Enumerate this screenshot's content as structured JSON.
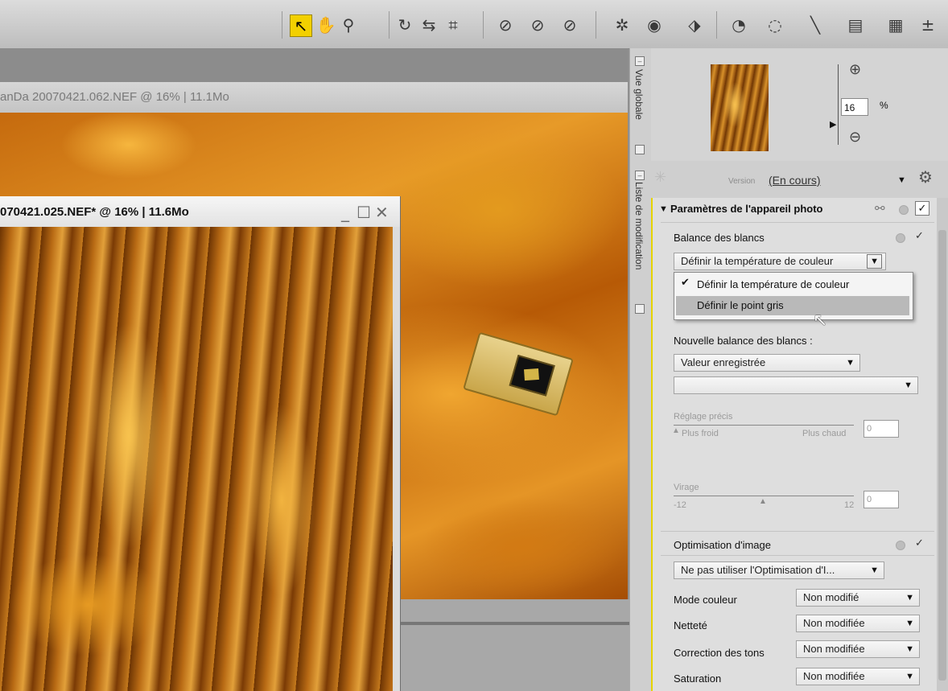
{
  "toolbar": {
    "tools": [
      "select-arrow-icon",
      "hand-icon",
      "magnify-icon",
      "rotate-icon",
      "straighten-icon",
      "crop-icon",
      "redeye-icon",
      "redeye2-icon",
      "redeye3-icon",
      "color-picker-icon",
      "eye-icon",
      "tag-icon",
      "control-point-icon",
      "color-control-point-icon",
      "line-brush-icon",
      "gradient-icon",
      "selection-icon"
    ],
    "active": "select-arrow-icon"
  },
  "window1": {
    "title": "anDa 20070421.062.NEF @ 16% | 11.1Mo"
  },
  "window2": {
    "title": "070421.025.NEF* @ 16% | 11.6Mo"
  },
  "sidestrip": {
    "overview_label": "Vue globale",
    "edit_list_label": "Liste de modification"
  },
  "overview": {
    "zoom_value": "16",
    "zoom_unit": "%"
  },
  "version": {
    "label": "Version",
    "value": "(En cours)"
  },
  "panel": {
    "section_title": "Paramètres de l'appareil photo",
    "white_balance": {
      "label": "Balance des blancs",
      "dropdown_value": "Définir la température de couleur",
      "options": [
        "Définir la température de couleur",
        "Définir le point gris"
      ],
      "selected_option": "Définir la température de couleur",
      "highlighted_option": "Définir le point gris",
      "new_label": "Nouvelle balance des blancs :",
      "new_value": "Valeur enregistrée",
      "second_value": "",
      "fine_label": "Réglage précis",
      "fine_min": "Plus froid",
      "fine_max": "Plus chaud",
      "fine_value": "0",
      "tint_label": "Virage",
      "tint_min": "-12",
      "tint_max": "12",
      "tint_value": "0"
    },
    "optimization": {
      "label": "Optimisation d'image",
      "dropdown_value": "Ne pas utiliser l'Optimisation d'I...",
      "rows": [
        {
          "label": "Mode couleur",
          "value": "Non modifié"
        },
        {
          "label": "Netteté",
          "value": "Non modifiée"
        },
        {
          "label": "Correction des tons",
          "value": "Non modifiée"
        },
        {
          "label": "Saturation",
          "value": "Non modifiée"
        }
      ]
    }
  }
}
